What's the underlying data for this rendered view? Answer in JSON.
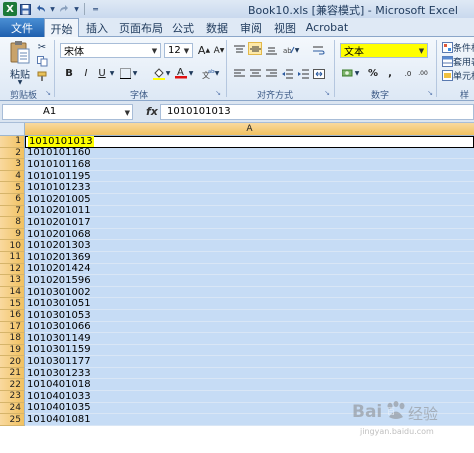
{
  "window": {
    "title": "Book10.xls  [兼容模式] - Microsoft Excel",
    "quick_access": [
      "save-icon",
      "undo-icon",
      "redo-icon",
      "customize-icon"
    ]
  },
  "tabs": {
    "file": "文件",
    "items": [
      "开始",
      "插入",
      "页面布局",
      "公式",
      "数据",
      "审阅",
      "视图",
      "Acrobat"
    ]
  },
  "ribbon": {
    "clipboard": {
      "paste_label": "粘贴",
      "group_label": "剪贴板"
    },
    "font": {
      "name": "宋体",
      "size": "12",
      "group_label": "字体",
      "bold": "B",
      "italic": "I",
      "underline": "U",
      "grow": "A",
      "shrink": "A"
    },
    "alignment": {
      "group_label": "对齐方式"
    },
    "number": {
      "format": "文本",
      "group_label": "数字",
      "percent": "%",
      "comma": ",",
      "inc_decimal": ".0",
      "dec_decimal": ".00"
    },
    "styles": {
      "items": [
        "条件格",
        "套用表",
        "单元格"
      ],
      "group_label": "样"
    }
  },
  "formula_bar": {
    "name_box": "A1",
    "fx": "fx",
    "content": "1010101013"
  },
  "sheet": {
    "column_header": "A",
    "rows": [
      {
        "n": "1",
        "v": "1010101013"
      },
      {
        "n": "2",
        "v": "1010101160"
      },
      {
        "n": "3",
        "v": "1010101168"
      },
      {
        "n": "4",
        "v": "1010101195"
      },
      {
        "n": "5",
        "v": "1010101233"
      },
      {
        "n": "6",
        "v": "1010201005"
      },
      {
        "n": "7",
        "v": "1010201011"
      },
      {
        "n": "8",
        "v": "1010201017"
      },
      {
        "n": "9",
        "v": "1010201068"
      },
      {
        "n": "10",
        "v": "1010201303"
      },
      {
        "n": "11",
        "v": "1010201369"
      },
      {
        "n": "12",
        "v": "1010201424"
      },
      {
        "n": "13",
        "v": "1010201596"
      },
      {
        "n": "14",
        "v": "1010301002"
      },
      {
        "n": "15",
        "v": "1010301051"
      },
      {
        "n": "16",
        "v": "1010301053"
      },
      {
        "n": "17",
        "v": "1010301066"
      },
      {
        "n": "18",
        "v": "1010301149"
      },
      {
        "n": "19",
        "v": "1010301159"
      },
      {
        "n": "20",
        "v": "1010301177"
      },
      {
        "n": "21",
        "v": "1010301233"
      },
      {
        "n": "22",
        "v": "1010401018"
      },
      {
        "n": "23",
        "v": "1010401033"
      },
      {
        "n": "24",
        "v": "1010401035"
      },
      {
        "n": "25",
        "v": "1010401081"
      }
    ]
  },
  "watermark": {
    "brand": "Bai",
    "du": "百",
    "jingyan": "经验",
    "url": "jingyan.baidu.com"
  },
  "colors": {
    "highlight": "#ffff00",
    "selection": "#c6dcf5",
    "header_selected": "#f1c15f",
    "file_tab": "#1f5fae"
  }
}
